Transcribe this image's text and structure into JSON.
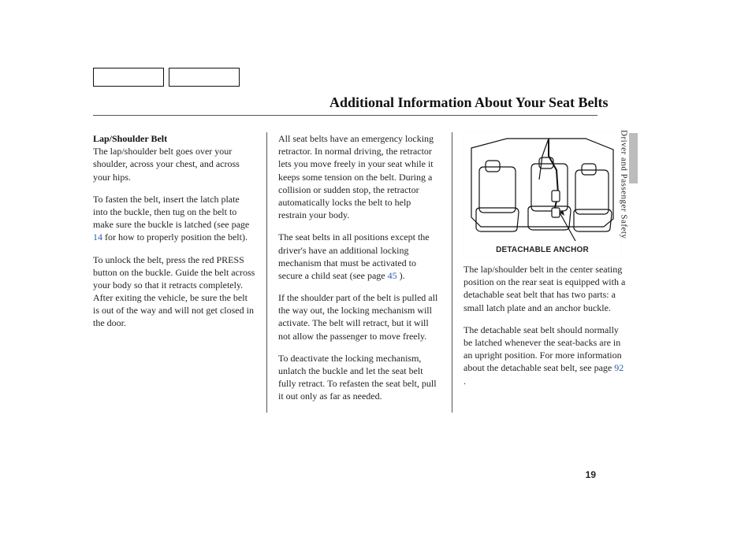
{
  "title": "Additional Information About Your Seat Belts",
  "section_tab": "Driver and Passenger Safety",
  "page_number": "19",
  "col1": {
    "heading": "Lap/Shoulder Belt",
    "p1": "The lap/shoulder belt goes over your shoulder, across your chest, and across your hips.",
    "p2a": "To fasten the belt, insert the latch plate into the buckle, then tug on the belt to make sure the buckle is latched (see page ",
    "p2_link": "14",
    "p2b": " for how to properly position the belt).",
    "p3": "To unlock the belt, press the red PRESS button on the buckle. Guide the belt across your body so that it retracts completely. After exiting the vehicle, be sure the belt is out of the way and will not get closed in the door."
  },
  "col2": {
    "p1": "All seat belts have an emergency locking retractor. In normal driving, the retractor lets you move freely in your seat while it keeps some tension on the belt. During a collision or sudden stop, the retractor automatically locks the belt to help restrain your body.",
    "p2a": "The seat belts in all positions except the driver's have an additional locking mechanism that must be activated to secure a child seat (see page ",
    "p2_link": "45",
    "p2b": " ).",
    "p3": "If the shoulder part of the belt is pulled all the way out, the locking mechanism will activate. The belt will retract, but it will not allow the passenger to move freely.",
    "p4": "To deactivate the locking mechanism, unlatch the buckle and let the seat belt fully retract. To refasten the seat belt, pull it out only as far as needed."
  },
  "col3": {
    "figure_caption": "DETACHABLE ANCHOR",
    "p1": "The lap/shoulder belt in the center seating position on the rear seat is equipped with a detachable seat belt that has two parts: a small latch plate and an anchor buckle.",
    "p2a": "The detachable seat belt should normally be latched whenever the seat-backs are in an upright position. For more information about the detachable seat belt, see page  ",
    "p2_link": "92",
    "p2b": "  ."
  }
}
